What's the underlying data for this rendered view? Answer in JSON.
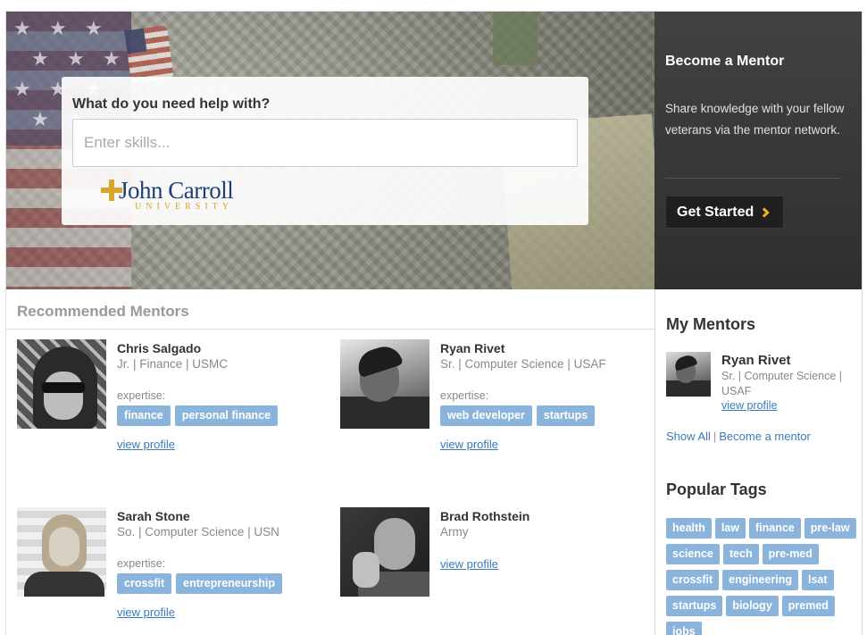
{
  "hero": {
    "search_heading": "What do you need help with?",
    "search_placeholder": "Enter skills...",
    "logo": {
      "line1": "John Carroll",
      "line2": "UNIVERSITY"
    }
  },
  "become_mentor": {
    "title": "Become a Mentor",
    "description": "Share knowledge with your fellow veterans via the mentor network.",
    "button_label": "Get Started"
  },
  "recommended": {
    "title": "Recommended Mentors",
    "expertise_label": "expertise:",
    "view_profile_label": "view profile",
    "mentors": [
      {
        "name": "Chris Salgado",
        "meta": "Jr. | Finance | USMC",
        "tags": [
          "finance",
          "personal finance"
        ]
      },
      {
        "name": "Ryan Rivet",
        "meta": "Sr. | Computer Science | USAF",
        "tags": [
          "web developer",
          "startups"
        ]
      },
      {
        "name": "Sarah Stone",
        "meta": "So. | Computer Science | USN",
        "tags": [
          "crossfit",
          "entrepreneurship"
        ]
      },
      {
        "name": "Brad Rothstein",
        "meta": "Army",
        "tags": []
      }
    ]
  },
  "my_mentors": {
    "title": "My Mentors",
    "mentor": {
      "name": "Ryan Rivet",
      "meta": "Sr. | Computer Science | USAF",
      "view_profile": "view profile"
    },
    "show_all": "Show All",
    "separator": "|",
    "become_link": "Become a mentor"
  },
  "popular_tags": {
    "title": "Popular Tags",
    "tags": [
      "health",
      "law",
      "finance",
      "pre-law",
      "science",
      "tech",
      "pre-med",
      "crossfit",
      "engineering",
      "lsat",
      "startups",
      "biology",
      "premed",
      "jobs"
    ]
  },
  "colors": {
    "tag_bg": "#8ab4dc",
    "link": "#3a7ab8",
    "dark_panel": "#383838",
    "accent_chevron": "#e8b52a",
    "logo_blue": "#1c3f75",
    "logo_gold": "#d9a52a"
  }
}
